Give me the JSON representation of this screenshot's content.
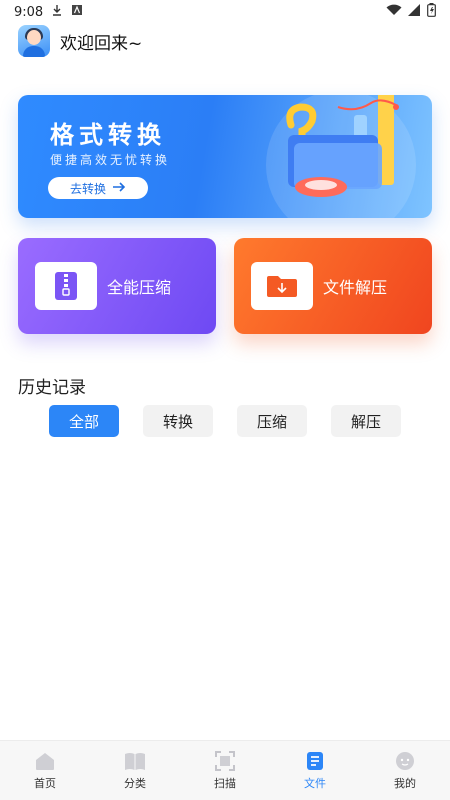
{
  "status_bar": {
    "time": "9:08",
    "icons": [
      "download-icon",
      "a-icon",
      "wifi-icon",
      "cellular-icon",
      "battery-icon"
    ]
  },
  "header": {
    "welcome": "欢迎回来~"
  },
  "banner": {
    "title": "格式转换",
    "subtitle": "便捷高效无忧转换",
    "button_label": "去转换",
    "button_icon": "arrow-right-icon"
  },
  "cards": {
    "compress_label": "全能压缩",
    "extract_label": "文件解压"
  },
  "history": {
    "title": "历史记录",
    "filters": [
      "全部",
      "转换",
      "压缩",
      "解压"
    ],
    "active_filter": "全部"
  },
  "bottom_nav": {
    "items": [
      {
        "label": "首页",
        "icon": "home-icon"
      },
      {
        "label": "分类",
        "icon": "book-icon"
      },
      {
        "label": "扫描",
        "icon": "scan-icon"
      },
      {
        "label": "文件",
        "icon": "file-icon"
      },
      {
        "label": "我的",
        "icon": "profile-icon"
      }
    ],
    "active_index": 3
  },
  "colors": {
    "accent": "#2c86f7",
    "compress_card": "#7b55f5",
    "extract_card": "#f45a24"
  }
}
